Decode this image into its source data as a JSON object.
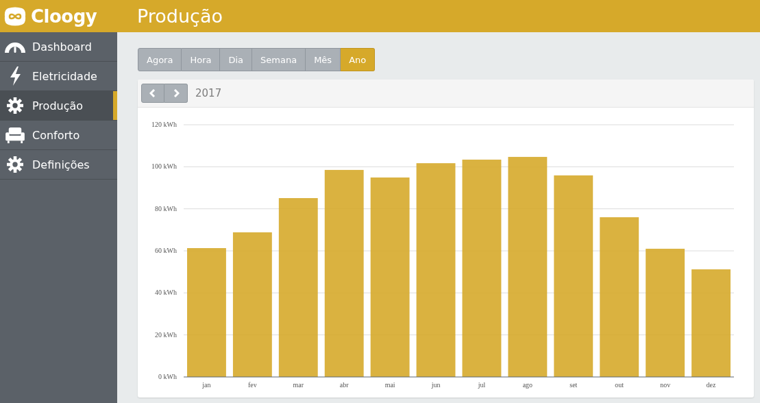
{
  "app": {
    "name": "Cloogy"
  },
  "header": {
    "title": "Produção"
  },
  "sidebar": {
    "items": [
      {
        "label": "Dashboard",
        "kind": "gauge",
        "selected": false
      },
      {
        "label": "Eletricidade",
        "kind": "bolt",
        "selected": false
      },
      {
        "label": "Produção",
        "kind": "sun-gear",
        "selected": true
      },
      {
        "label": "Conforto",
        "kind": "armchair",
        "selected": false
      },
      {
        "label": "Definições",
        "kind": "gear",
        "selected": false
      }
    ]
  },
  "period_tabs": [
    {
      "label": "Agora",
      "selected": false
    },
    {
      "label": "Hora",
      "selected": false
    },
    {
      "label": "Dia",
      "selected": false
    },
    {
      "label": "Semana",
      "selected": false
    },
    {
      "label": "Mês",
      "selected": false
    },
    {
      "label": "Ano",
      "selected": true
    }
  ],
  "period": {
    "label": "2017"
  },
  "chart_data": {
    "type": "bar",
    "categories": [
      "jan",
      "fev",
      "mar",
      "abr",
      "mai",
      "jun",
      "jul",
      "ago",
      "set",
      "out",
      "nov",
      "dez"
    ],
    "grid": true,
    "series": [
      {
        "color": "#d6aa2b",
        "values": [
          61.3,
          68.8,
          85.1,
          98.5,
          94.9,
          101.7,
          103.4,
          104.7,
          95.9,
          76,
          61,
          51.2
        ]
      }
    ],
    "ylim": [
      0,
      120
    ],
    "yticks": [
      {
        "value": 0,
        "label": "0 kWh"
      },
      {
        "value": 20,
        "label": "20 kWh"
      },
      {
        "value": 40,
        "label": "40 kWh"
      },
      {
        "value": 60,
        "label": "60 kWh"
      },
      {
        "value": 80,
        "label": "80 kWh"
      },
      {
        "value": 100,
        "label": "100 kWh"
      },
      {
        "value": 120,
        "label": "120 kWh"
      }
    ]
  }
}
